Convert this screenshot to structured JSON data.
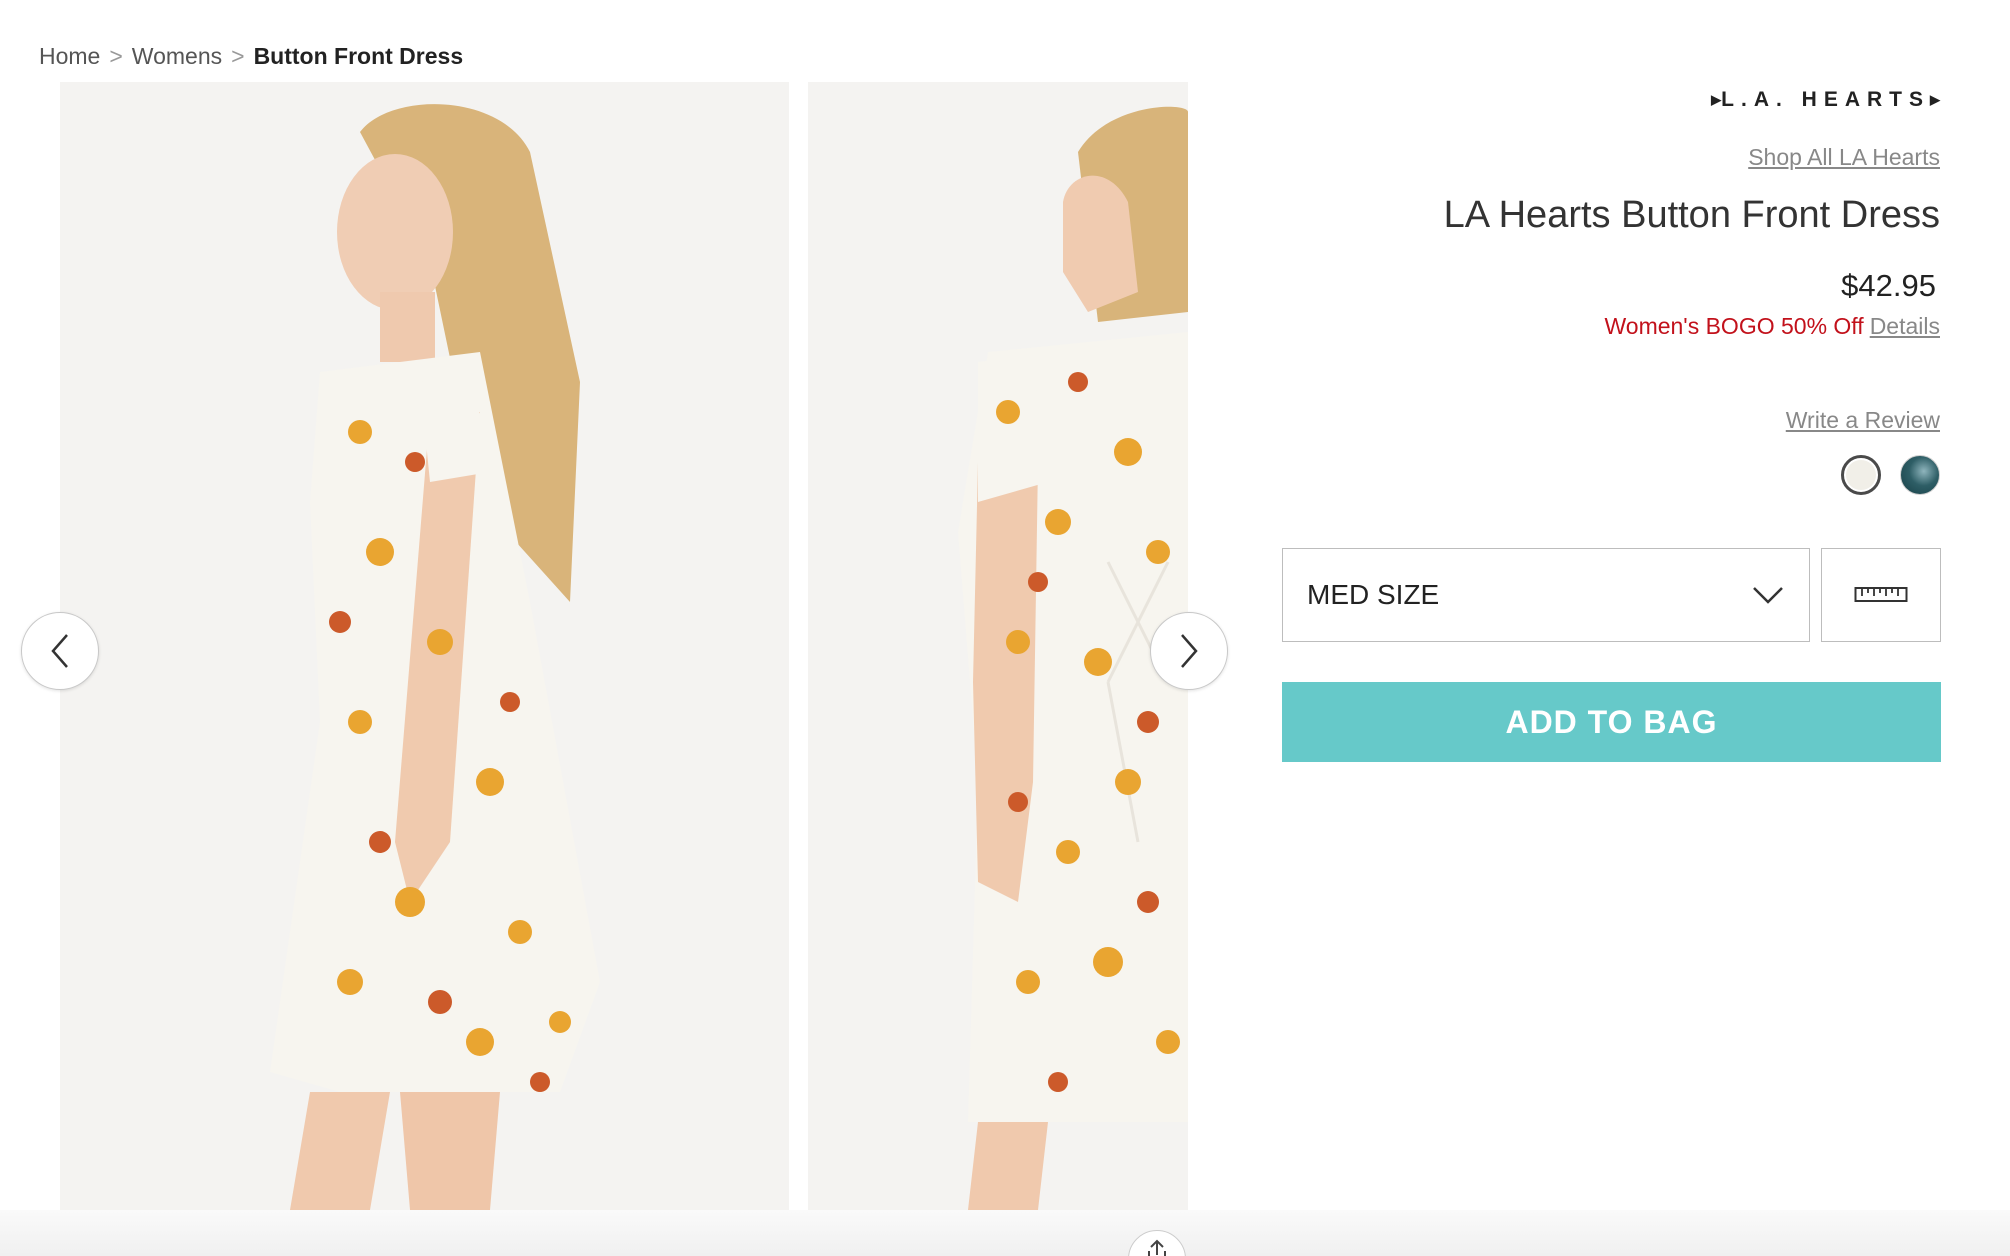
{
  "breadcrumb": {
    "items": [
      "Home",
      "Womens"
    ],
    "separator": ">",
    "current": "Button Front Dress"
  },
  "gallery": {
    "images": [
      {
        "alt": "",
        "view": "side"
      },
      {
        "alt": "",
        "view": "back"
      }
    ],
    "prev_icon": "chevron-left-icon",
    "next_icon": "chevron-right-icon",
    "share_icon": "share-icon"
  },
  "product": {
    "brand": "L.A. HEARTS",
    "shop_all": "Shop All LA Hearts",
    "title": "LA Hearts Button Front Dress",
    "price": "$42.95",
    "promo": "Women's BOGO 50% Off",
    "promo_details": "Details",
    "write_review": "Write a Review",
    "swatches": [
      {
        "color": "#f1efe8",
        "selected": true
      },
      {
        "color": "#2e5e66",
        "selected": false
      }
    ],
    "size_selected": "MED SIZE",
    "size_guide_icon": "ruler-icon",
    "add_to_bag": "ADD TO BAG"
  },
  "colors": {
    "accent": "#66c9c9",
    "promo": "#c2111b",
    "link": "#888888"
  }
}
